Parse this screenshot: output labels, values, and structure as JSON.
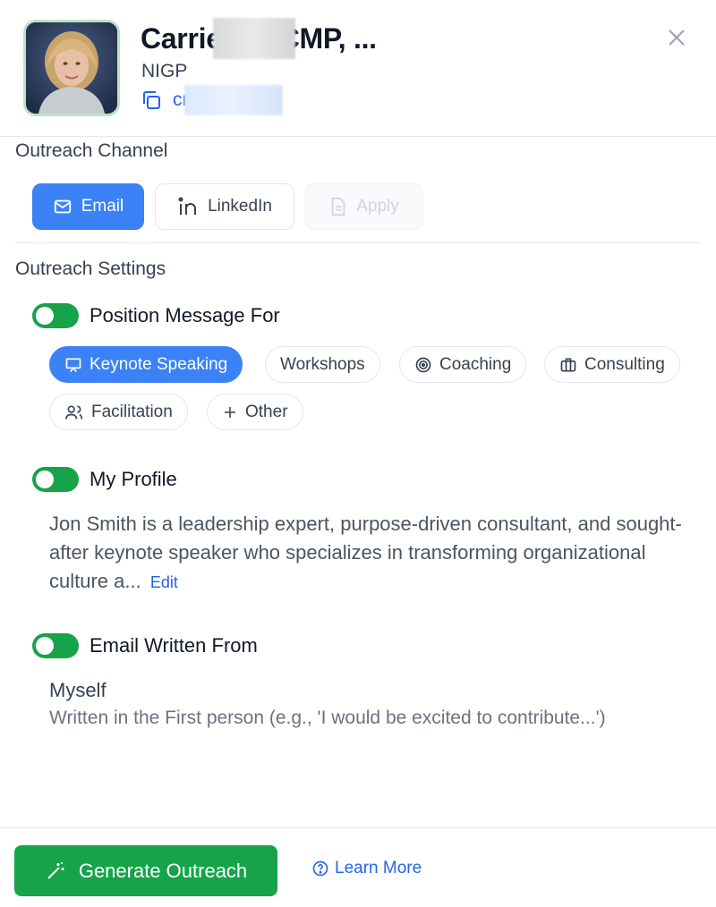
{
  "contact": {
    "name": "Carrie      ter, CMP, ...",
    "organization": "NIGP",
    "email": "cr                    p.org"
  },
  "outreach_channel": {
    "title": "Outreach Channel",
    "channels": [
      {
        "label": "Email",
        "icon": "mail-icon",
        "state": "active"
      },
      {
        "label": "LinkedIn",
        "icon": "linkedin-icon",
        "state": "default"
      },
      {
        "label": "Apply",
        "icon": "document-icon",
        "state": "disabled"
      }
    ]
  },
  "outreach_settings": {
    "title": "Outreach Settings",
    "position_message": {
      "label": "Position Message For",
      "enabled": true,
      "options": [
        {
          "label": "Keynote Speaking",
          "icon": "presentation-icon",
          "selected": true
        },
        {
          "label": "Workshops",
          "selected": false
        },
        {
          "label": "Coaching",
          "icon": "target-icon",
          "selected": false
        },
        {
          "label": "Consulting",
          "icon": "briefcase-icon",
          "selected": false
        },
        {
          "label": "Facilitation",
          "icon": "users-icon",
          "selected": false
        },
        {
          "label": "Other",
          "icon": "plus-icon",
          "selected": false
        }
      ]
    },
    "my_profile": {
      "label": "My Profile",
      "enabled": true,
      "text": "Jon Smith is a leadership expert, purpose-driven consultant, and sought-after keynote speaker who specializes in transforming organizational culture a...",
      "edit_label": "Edit"
    },
    "email_written_from": {
      "label": "Email Written From",
      "enabled": true,
      "value": "Myself",
      "description": "Written in the First person (e.g., 'I would be excited to contribute...')"
    }
  },
  "footer": {
    "generate_label": "Generate Outreach",
    "learn_more_label": "Learn More"
  },
  "colors": {
    "primary_blue": "#3b82f6",
    "link_blue": "#2563eb",
    "toggle_green": "#16a34a",
    "generate_green": "#16a34a"
  }
}
